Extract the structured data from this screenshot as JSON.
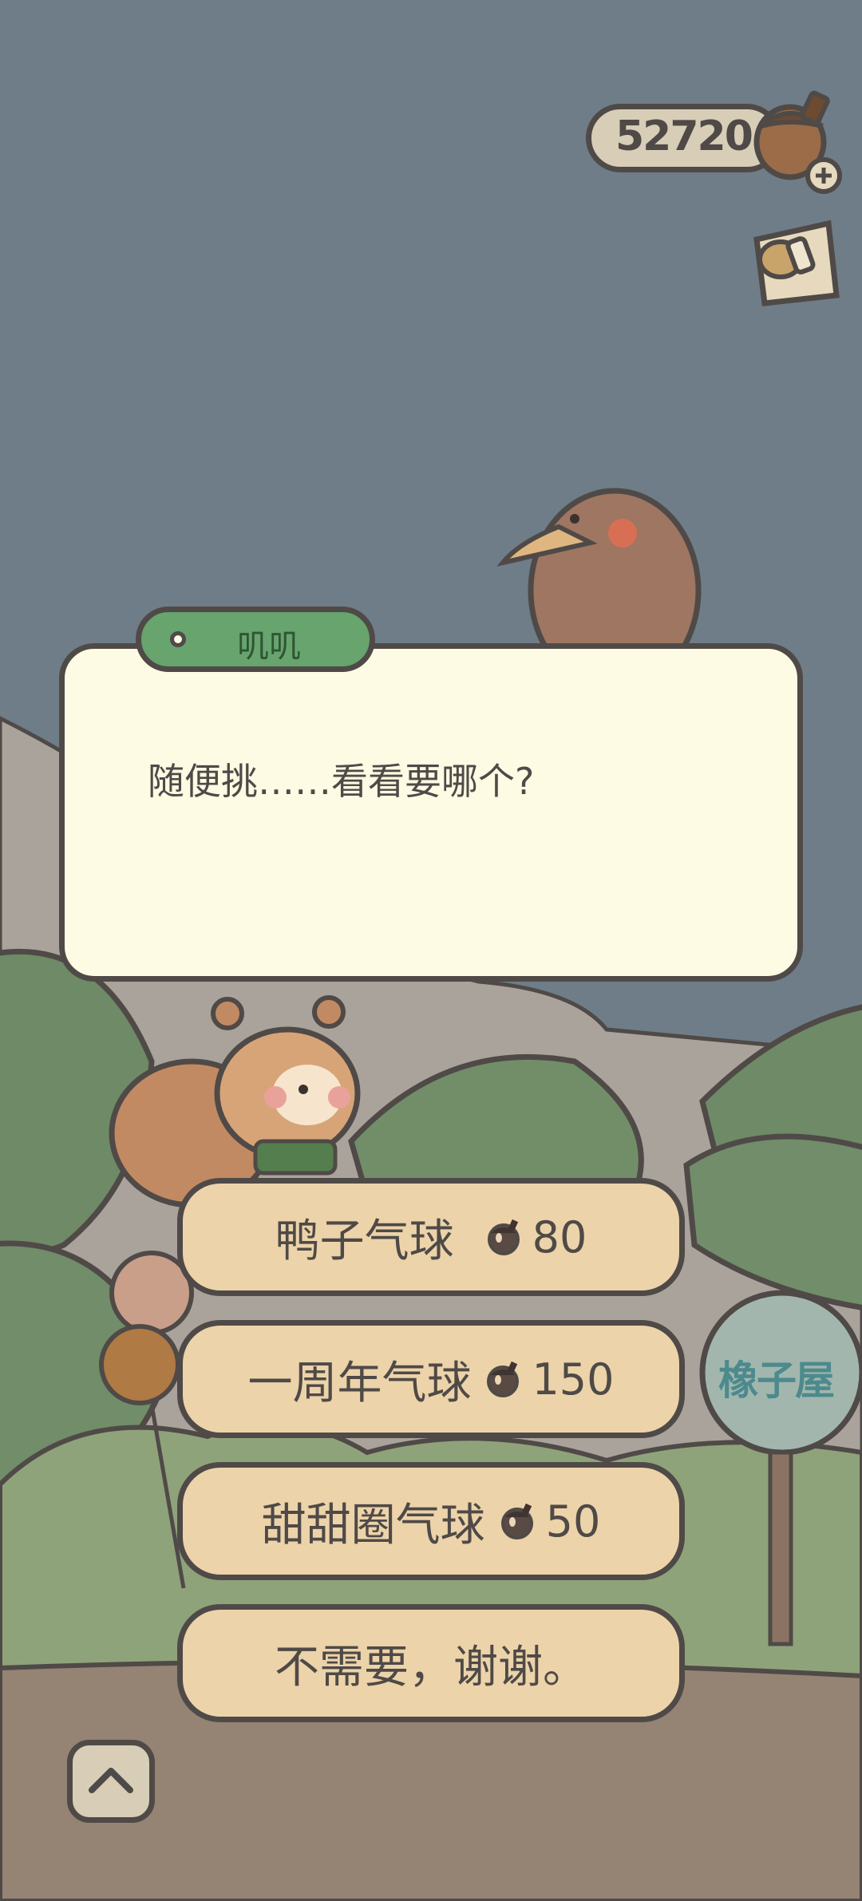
{
  "hud": {
    "acorn_count": "52720"
  },
  "dialog": {
    "speaker": "叽叽",
    "text": "随便挑……看看要哪个?"
  },
  "choices": [
    {
      "label": "鸭子气球",
      "price": "80"
    },
    {
      "label": "一周年气球",
      "price": "150"
    },
    {
      "label": "甜甜圈气球",
      "price": "50"
    },
    {
      "label": "不需要，谢谢。"
    }
  ],
  "sign": {
    "text": "橡子屋"
  },
  "colors": {
    "sky": "#6f7d88",
    "dialog_bg": "#fdfbe3",
    "speaker_tag": "#67a46e",
    "choice_bg": "#ecd3a9",
    "outline": "#4f4a47",
    "ground": "#958373"
  }
}
